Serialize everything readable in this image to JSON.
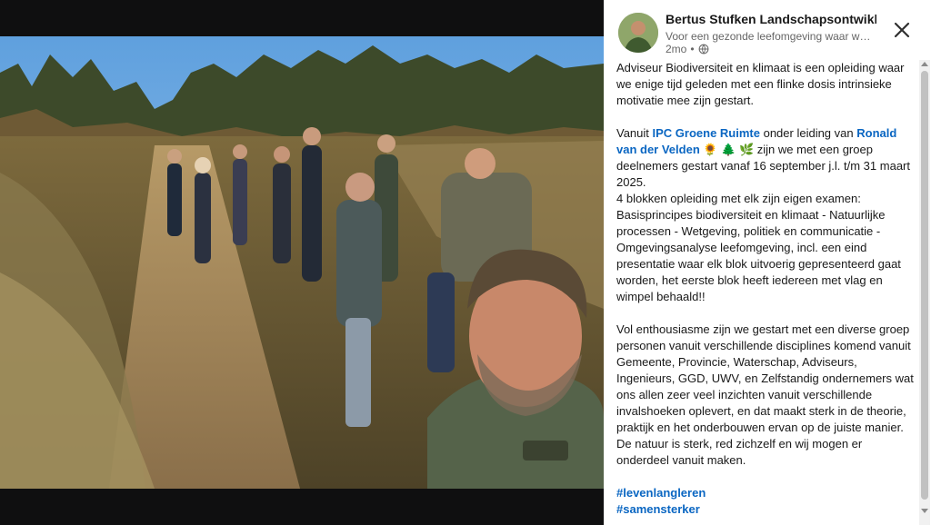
{
  "post": {
    "author": "Bertus Stufken Landschapsontwikkeling",
    "headline": "Voor een gezonde leefomgeving waar we wonen, werken en recreëren",
    "time": "2mo",
    "separator": "•",
    "close_icon": "close-icon",
    "visibility_icon": "globe-icon",
    "p1": "Adviseur Biodiversiteit en klimaat is een opleiding waar we enige tijd geleden met een flinke dosis intrinsieke motivatie mee zijn gestart.",
    "p2_a": "Vanuit ",
    "p2_mention1": "IPC Groene Ruimte",
    "p2_b": " onder leiding van ",
    "p2_mention2": "Ronald van der Velden",
    "p2_c": " 🌻 🌲 🌿 zijn we met een groep deelnemers gestart vanaf 16 september j.l. t/m 31 maart 2025.",
    "p2_d": "4 blokken opleiding met elk zijn eigen examen: Basisprincipes biodiversiteit en klimaat - Natuurlijke processen - Wetgeving, politiek en communicatie - Omgevingsanalyse leefomgeving, incl. een eind presentatie waar elk blok uitvoerig gepresenteerd gaat worden, het eerste blok heeft iedereen met vlag en wimpel behaald!!",
    "p3": "Vol enthousiasme zijn we gestart met een diverse groep personen vanuit verschillende disciplines komend vanuit Gemeente, Provincie, Waterschap, Adviseurs, Ingenieurs, GGD, UWV, en Zelfstandig ondernemers wat ons allen zeer veel inzichten vanuit verschillende invalshoeken oplevert, en dat maakt sterk in de theorie, praktijk en het onderbouwen ervan op de juiste manier. De natuur is sterk, red zichzelf en wij mogen er onderdeel vanuit maken.",
    "hashtags": [
      "#levenlangleren",
      "#samensterker"
    ]
  },
  "colors": {
    "link": "#0a66c2",
    "text": "#191919",
    "muted": "#666666"
  }
}
